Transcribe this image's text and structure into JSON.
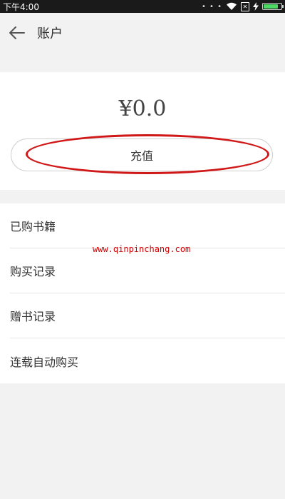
{
  "status_bar": {
    "time": "下午4:00",
    "overflow": "• • •",
    "sim_icon": "x-box-icon",
    "wifi_icon": "wifi-icon",
    "charging_icon": "bolt-icon",
    "battery_color": "#4cd964",
    "battery_level": 0.85
  },
  "header": {
    "back_icon": "arrow-left-icon",
    "title": "账户"
  },
  "balance": {
    "amount": "¥0.0",
    "recharge_label": "充值",
    "highlight_color": "#d01818"
  },
  "menu": {
    "items": [
      {
        "label": "已购书籍"
      },
      {
        "label": "购买记录"
      },
      {
        "label": "赠书记录"
      },
      {
        "label": "连载自动购买"
      }
    ]
  },
  "watermark": "www.qinpinchang.com"
}
